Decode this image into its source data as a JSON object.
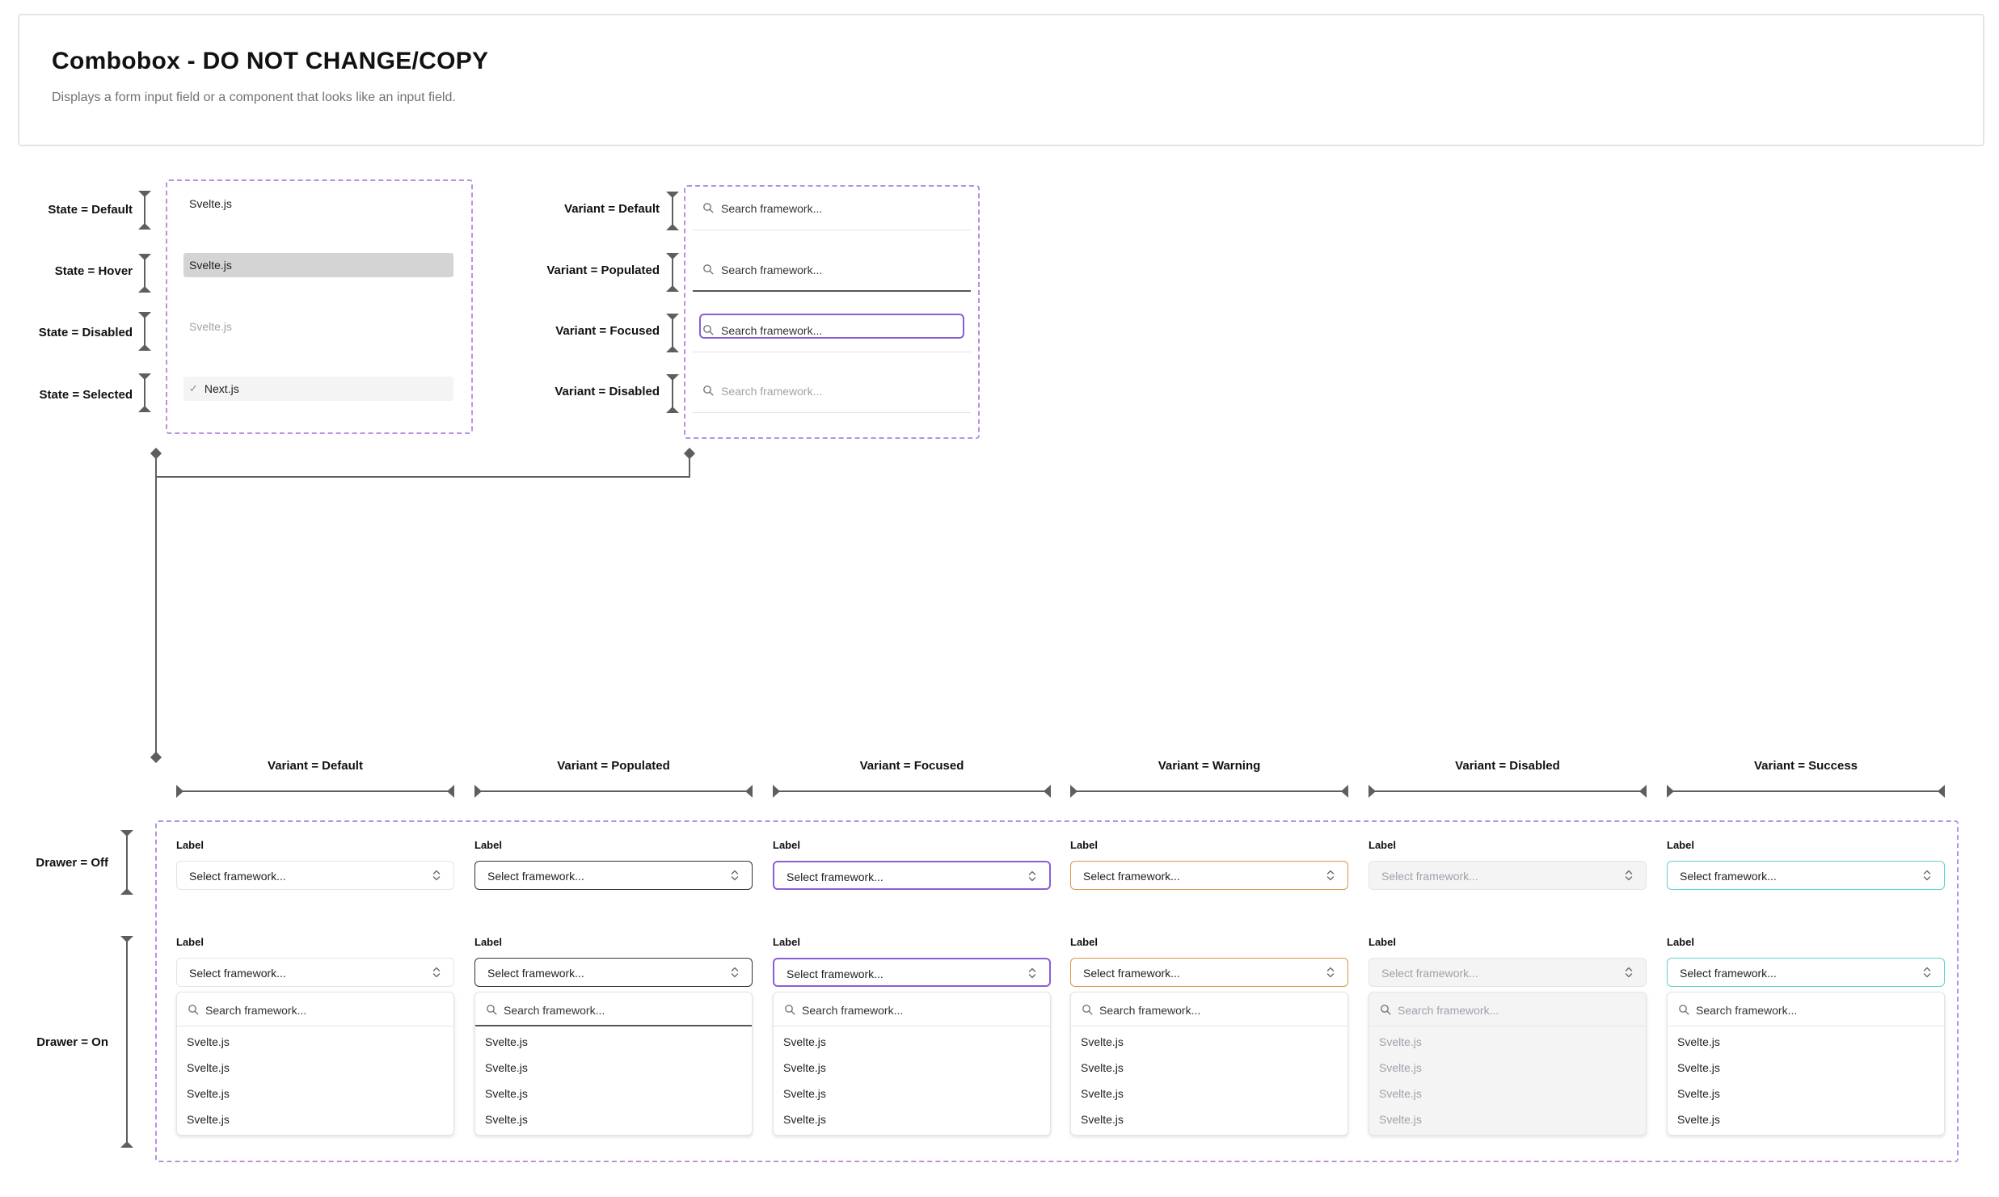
{
  "header": {
    "title": "Combobox - DO NOT CHANGE/COPY",
    "subtitle": "Displays a form input field or a component that looks like an input field."
  },
  "item_states": {
    "rows": [
      {
        "label": "State = Default",
        "value": "Svelte.js",
        "state": "default"
      },
      {
        "label": "State = Hover",
        "value": "Svelte.js",
        "state": "hover"
      },
      {
        "label": "State = Disabled",
        "value": "Svelte.js",
        "state": "disabled"
      },
      {
        "label": "State = Selected",
        "value": "Next.js",
        "state": "selected"
      }
    ]
  },
  "search_variants": {
    "rows": [
      {
        "label": "Variant = Default",
        "placeholder": "Search framework...",
        "variant": "default"
      },
      {
        "label": "Variant = Populated",
        "placeholder": "Search framework...",
        "variant": "populated"
      },
      {
        "label": "Variant = Focused",
        "placeholder": "Search framework...",
        "variant": "focused"
      },
      {
        "label": "Variant = Disabled",
        "placeholder": "Search framework...",
        "variant": "disabled"
      }
    ]
  },
  "combobox": {
    "drawer_labels": {
      "off": "Drawer = Off",
      "on": "Drawer = On"
    },
    "columns": [
      {
        "header": "Variant = Default",
        "variant": "default"
      },
      {
        "header": "Variant = Populated",
        "variant": "populated"
      },
      {
        "header": "Variant = Focused",
        "variant": "focused"
      },
      {
        "header": "Variant = Warning",
        "variant": "warning"
      },
      {
        "header": "Variant = Disabled",
        "variant": "disabled"
      },
      {
        "header": "Variant = Success",
        "variant": "success"
      }
    ],
    "field_label": "Label",
    "select_placeholder": "Select framework...",
    "search_placeholder": "Search framework...",
    "options": [
      "Svelte.js",
      "Svelte.js",
      "Svelte.js",
      "Svelte.js"
    ]
  },
  "colors": {
    "focus": "#8b5cd6",
    "warning": "#d9954a",
    "success": "#5fd1cb",
    "dashed_border": "#b892e0",
    "marker": "#5e5e5e"
  },
  "icons": {
    "search": "search-icon",
    "chevrons": "chevrons-up-down-icon",
    "check": "check-icon"
  }
}
